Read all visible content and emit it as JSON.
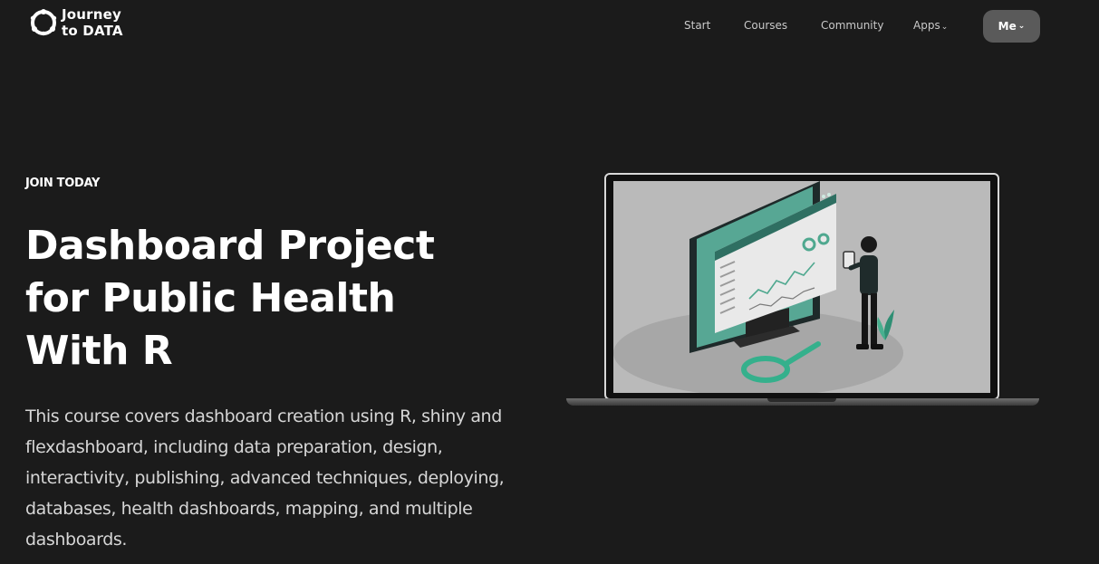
{
  "brand": {
    "line1": "Journey",
    "line2": "to DATA",
    "icon": "journey-to-data-logo"
  },
  "nav": {
    "items": [
      {
        "label": "Start"
      },
      {
        "label": "Courses"
      },
      {
        "label": "Community"
      },
      {
        "label": "Apps",
        "icon": "chevron-down-icon"
      }
    ],
    "me_label": "Me",
    "me_icon": "chevron-down-icon"
  },
  "hero": {
    "eyebrow": "JOIN TODAY",
    "title": "Dashboard Project for Public Health With R",
    "description": "This course covers dashboard creation using  R, shiny and flexdashboard, including data preparation, design, interactivity, publishing, advanced techniques, deploying, databases, health dashboards, mapping, and multiple dashboards.",
    "illustration": "laptop-dashboard-illustration"
  },
  "colors": {
    "background": "#1b1b1b",
    "text": "#ffffff",
    "muted_text": "#c9c9c9",
    "button_bg": "#5a5a5a",
    "accent_teal": "#4fa88f",
    "screen_bg": "#bababa"
  }
}
